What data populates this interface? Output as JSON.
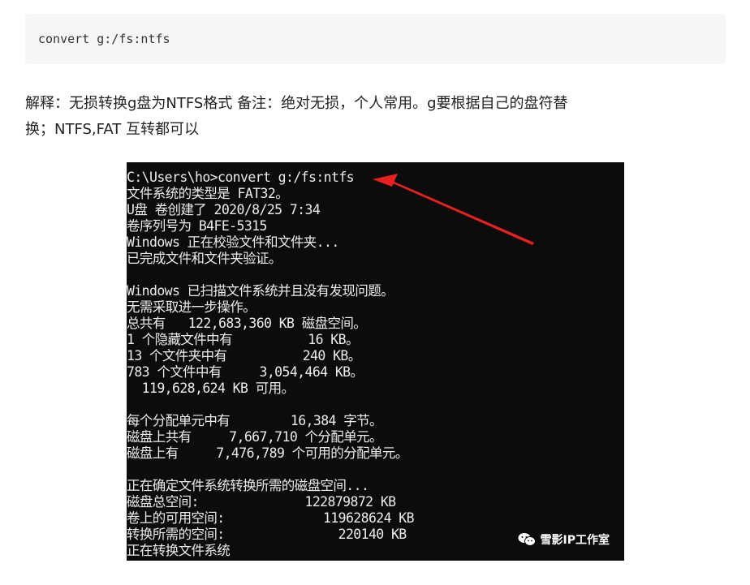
{
  "code_block": {
    "text": "convert g:/fs:ntfs"
  },
  "explanation": {
    "line1": "解释：无损转换g盘为NTFS格式 备注：绝对无损，个人常用。g要根据自己的盘符替",
    "line2": "换；NTFS,FAT 互转都可以"
  },
  "console": {
    "lines": [
      "C:\\Users\\ho>convert g:/fs:ntfs",
      "文件系统的类型是 FAT32。",
      "U盘 卷创建了 2020/8/25 7:34",
      "卷序列号为 B4FE-5315",
      "Windows 正在校验文件和文件夹...",
      "已完成文件和文件夹验证。",
      "",
      "Windows 已扫描文件系统并且没有发现问题。",
      "无需采取进一步操作。",
      "总共有   122,683,360 KB 磁盘空间。",
      "1 个隐藏文件中有          16 KB。",
      "13 个文件夹中有          240 KB。",
      "783 个文件中有     3,054,464 KB。",
      "  119,628,624 KB 可用。",
      "",
      "每个分配单元中有        16,384 字节。",
      "磁盘上共有     7,667,710 个分配单元。",
      "磁盘上有     7,476,789 个可用的分配单元。",
      "",
      "正在确定文件系统转换所需的磁盘空间...",
      "磁盘总空间:              122879872 KB",
      "卷上的可用空间:             119628624 KB",
      "转换所需的空间:               220140 KB",
      "正在转换文件系统"
    ],
    "watermark": "雪影IP工作室",
    "arrow_color": "#e8201f",
    "watermark_icon": "wechat-icon"
  }
}
